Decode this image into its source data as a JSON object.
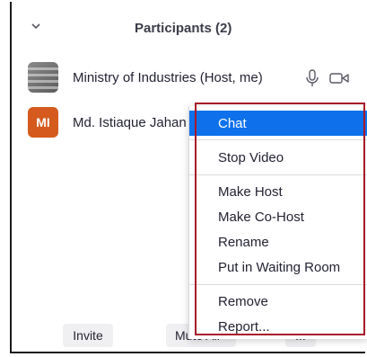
{
  "panel": {
    "title": "Participants (2)",
    "collapse_icon": "chevron-down-icon"
  },
  "participants": [
    {
      "name": "Ministry of Industries (Host, me)",
      "avatar": "photo",
      "icons": [
        "microphone-icon",
        "video-camera-icon"
      ]
    },
    {
      "name": "Md. Istiaque Jahan",
      "initials": "MI",
      "avatar_color": "#d45a1e"
    }
  ],
  "context_menu": {
    "items": [
      {
        "label": "Chat",
        "selected": true
      },
      {
        "label": "Stop Video"
      },
      {
        "label": "Make Host"
      },
      {
        "label": "Make Co-Host"
      },
      {
        "label": "Rename"
      },
      {
        "label": "Put in Waiting Room"
      },
      {
        "label": "Remove"
      },
      {
        "label": "Report..."
      }
    ]
  },
  "footer": {
    "invite_label": "Invite",
    "mute_all_label": "Mute All",
    "more_label": "..."
  },
  "colors": {
    "selection": "#0e71eb",
    "highlight_outline": "#a8192a",
    "avatar_initials_bg": "#d45a1e"
  }
}
